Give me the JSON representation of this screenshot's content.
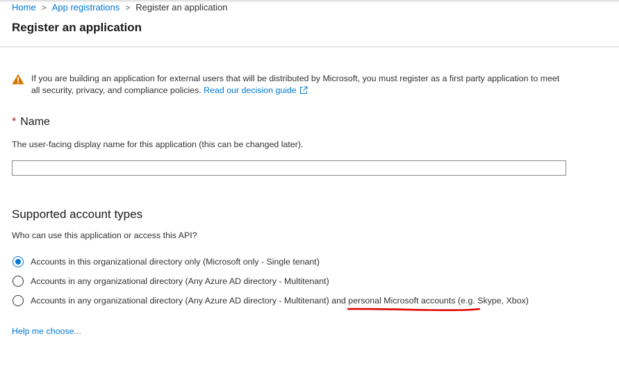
{
  "breadcrumb": {
    "home": "Home",
    "app_registrations": "App registrations",
    "current": "Register an application",
    "separator": ">"
  },
  "page": {
    "title": "Register an application"
  },
  "warning": {
    "icon": "warning-icon",
    "icon_color": "#d47500",
    "text": "If you are building an application for external users that will be distributed by Microsoft, you must register as a first party application to meet all security, privacy, and compliance policies.",
    "link_text": "Read our decision guide",
    "link_icon": "open-in-new-window-icon"
  },
  "name_section": {
    "required_marker": "*",
    "label": "Name",
    "help_text": "The user-facing display name for this application (this can be changed later).",
    "input_value": ""
  },
  "account_types": {
    "title": "Supported account types",
    "subtitle": "Who can use this application or access this API?",
    "options": [
      {
        "label": "Accounts in this organizational directory only (Microsoft only - Single tenant)",
        "selected": true
      },
      {
        "label": "Accounts in any organizational directory (Any Azure AD directory - Multitenant)",
        "selected": false
      },
      {
        "label": "Accounts in any organizational directory (Any Azure AD directory - Multitenant) and personal Microsoft accounts (e.g. Skype, Xbox)",
        "selected": false
      }
    ],
    "help_link": "Help me choose..."
  },
  "colors": {
    "accent": "#0078d4",
    "required": "#a4262c",
    "annotation_underline": "#e00000"
  }
}
